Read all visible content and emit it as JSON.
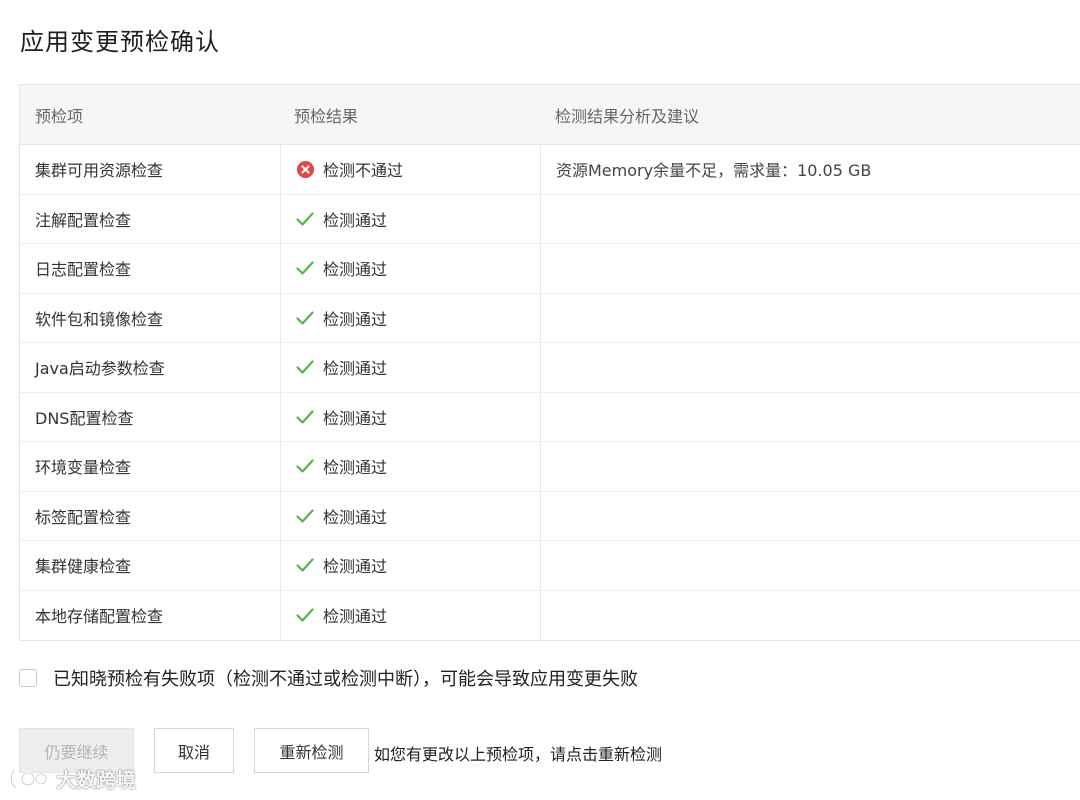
{
  "page": {
    "title": "应用变更预检确认"
  },
  "table": {
    "headers": [
      "预检项",
      "预检结果",
      "检测结果分析及建议"
    ],
    "rows": [
      {
        "item": "集群可用资源检查",
        "result": "检测不通过",
        "status": "fail",
        "advice": "资源Memory余量不足，需求量：10.05 GB"
      },
      {
        "item": "注解配置检查",
        "result": "检测通过",
        "status": "pass",
        "advice": ""
      },
      {
        "item": "日志配置检查",
        "result": "检测通过",
        "status": "pass",
        "advice": ""
      },
      {
        "item": "软件包和镜像检查",
        "result": "检测通过",
        "status": "pass",
        "advice": ""
      },
      {
        "item": "Java启动参数检查",
        "result": "检测通过",
        "status": "pass",
        "advice": ""
      },
      {
        "item": "DNS配置检查",
        "result": "检测通过",
        "status": "pass",
        "advice": ""
      },
      {
        "item": "环境变量检查",
        "result": "检测通过",
        "status": "pass",
        "advice": ""
      },
      {
        "item": "标签配置检查",
        "result": "检测通过",
        "status": "pass",
        "advice": ""
      },
      {
        "item": "集群健康检查",
        "result": "检测通过",
        "status": "pass",
        "advice": ""
      },
      {
        "item": "本地存储配置检查",
        "result": "检测通过",
        "status": "pass",
        "advice": ""
      }
    ]
  },
  "confirm": {
    "label": "已知晓预检有失败项（检测不通过或检测中断），可能会导致应用变更失败",
    "checked": false
  },
  "actions": {
    "continue_label": "仍要继续",
    "continue_disabled": true,
    "cancel_label": "取消",
    "recheck_label": "重新检测",
    "hint": "如您有更改以上预检项，请点击重新检测"
  },
  "watermark": {
    "text": "大数跨境"
  },
  "colors": {
    "pass": "#52b548",
    "fail": "#e54545",
    "header_bg": "#f6f6f6",
    "border": "#e6e6e6"
  },
  "icons": {
    "pass": "check-icon",
    "fail": "error-circle-icon"
  }
}
